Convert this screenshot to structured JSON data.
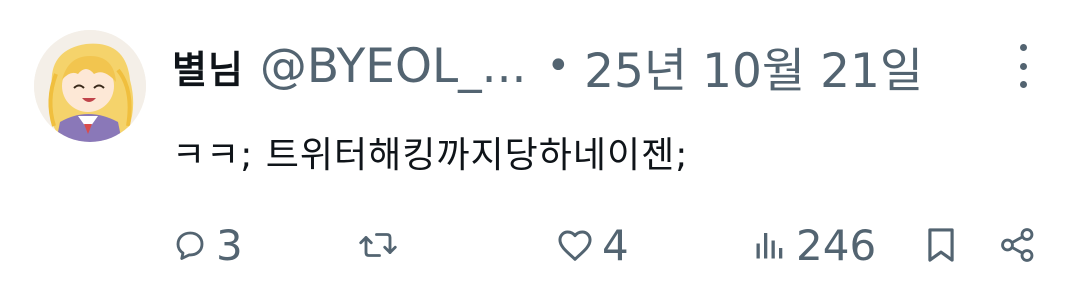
{
  "tweet": {
    "display_name": "별님",
    "handle": "@BYEOL_...",
    "separator": "•",
    "date": "25년 10월 21일",
    "text": "ㅋㅋ; 트위터해킹까지당하네이젠;"
  },
  "actions": {
    "replies": "3",
    "retweets": "",
    "likes": "4",
    "views": "246"
  },
  "icons": {
    "more": "more-vertical-icon",
    "reply": "reply-bubble-icon",
    "retweet": "retweet-icon",
    "like": "heart-icon",
    "views": "views-bar-chart-icon",
    "bookmark": "bookmark-icon",
    "share": "share-icon"
  },
  "colors": {
    "primary_text": "#0f1419",
    "secondary_text": "#536471",
    "background": "#ffffff"
  }
}
